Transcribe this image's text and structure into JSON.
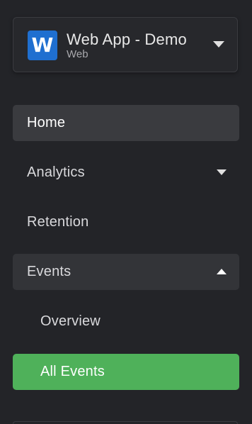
{
  "app_switcher": {
    "logo_letter": "W",
    "title": "Web App - Demo",
    "subtitle": "Web",
    "icon": "chevron-down-icon"
  },
  "nav": {
    "items": [
      {
        "label": "Home",
        "state": "active"
      },
      {
        "label": "Analytics",
        "icon": "chevron-down-icon"
      },
      {
        "label": "Retention"
      },
      {
        "label": "Events",
        "state": "expanded",
        "icon": "chevron-up-icon"
      },
      {
        "label": "Overview",
        "level": "sub"
      },
      {
        "label": "All Events",
        "level": "sub",
        "state": "selected"
      }
    ]
  },
  "colors": {
    "background": "#232428",
    "logo": "#1f6fd0",
    "selected": "#4fb15a",
    "active": "#3a3b3f"
  }
}
